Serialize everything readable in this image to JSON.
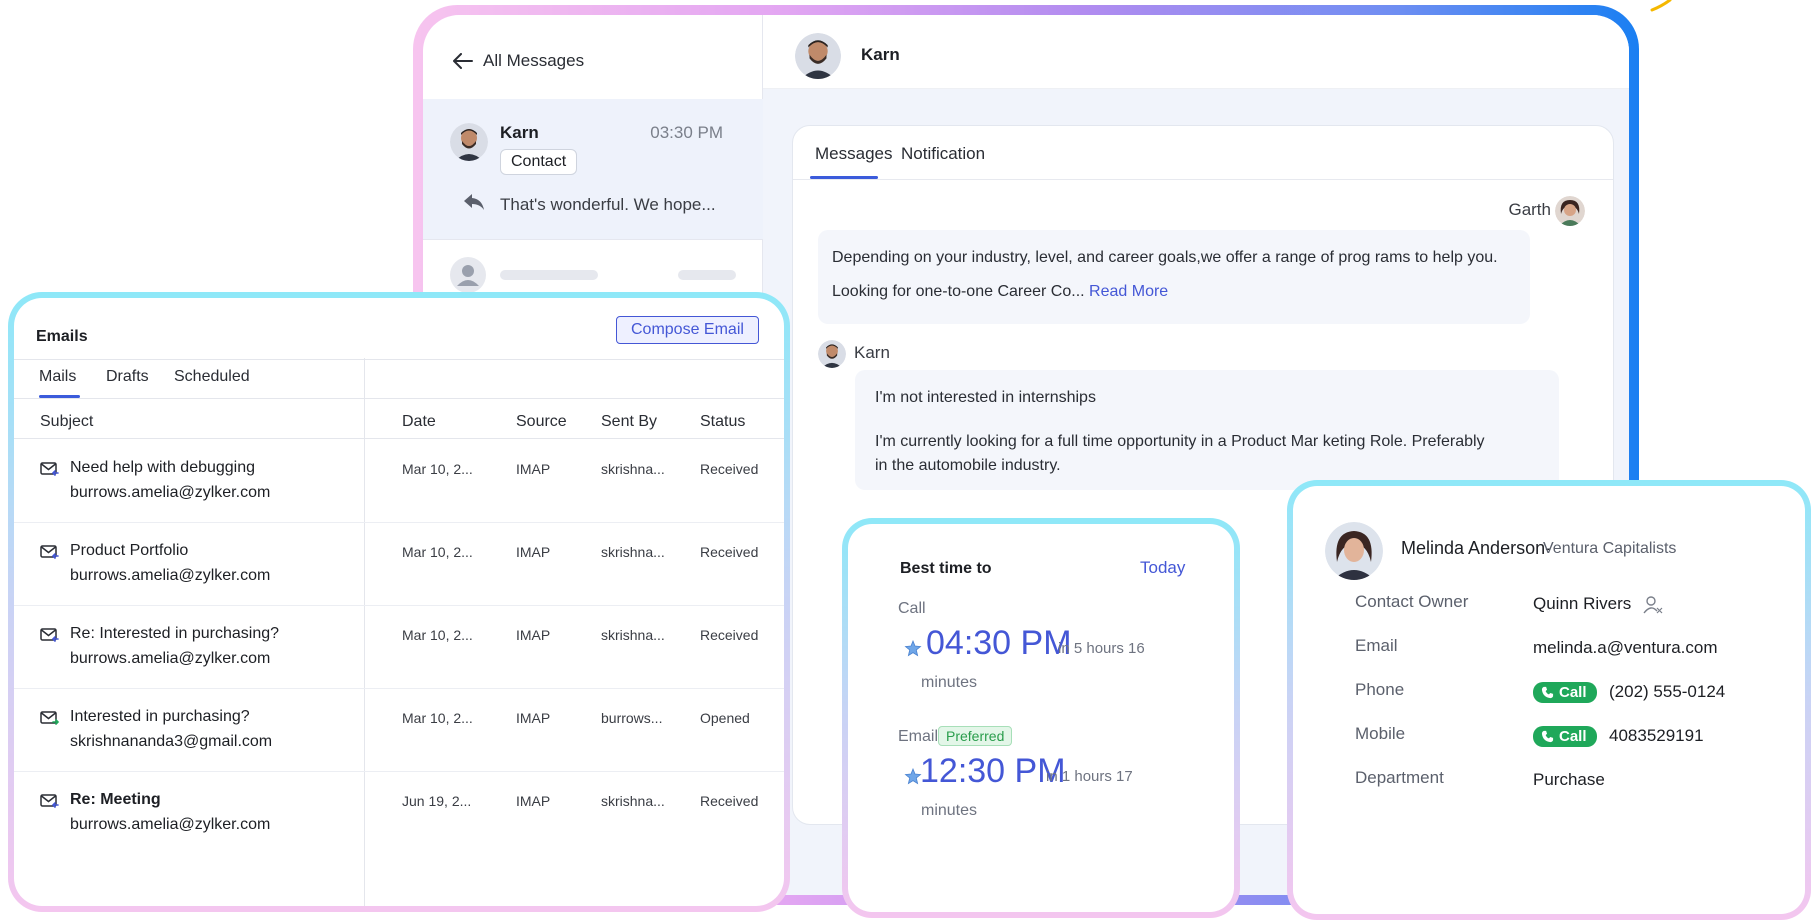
{
  "messages": {
    "back_label": "All Messages",
    "conversation": {
      "name": "Karn",
      "time": "03:30 PM",
      "tag": "Contact",
      "preview": "That's wonderful. We hope..."
    },
    "header_name": "Karn",
    "tabs": [
      "Messages",
      "Notification"
    ],
    "garth": {
      "name": "Garth",
      "line1": "Depending on  your industry, level, and career goals,we offer a  range of prog rams to help  you.",
      "line2": "Looking for one-to-one Career Co...",
      "read_more": "Read More"
    },
    "karn": {
      "name": "Karn",
      "line1": "I'm not interested in internships",
      "line2": "I'm currently looking for a full time opportunity in a Product Mar  keting Role. Preferably",
      "line3": "in the automobile industry."
    }
  },
  "emails": {
    "title": "Emails",
    "compose_label": "Compose Email",
    "tabs": [
      "Mails",
      "Drafts",
      "Scheduled"
    ],
    "columns": [
      "Subject",
      "Date",
      "Source",
      "Sent By",
      "Status"
    ],
    "rows": [
      {
        "subject": "Need help with debugging",
        "email": "burrows.amelia@zylker.com",
        "date": "Mar 10, 2...",
        "source": "IMAP",
        "sent_by": "skrishna...",
        "status": "Received",
        "bold": false
      },
      {
        "subject": "Product Portfolio",
        "email": "burrows.amelia@zylker.com",
        "date": "Mar 10, 2...",
        "source": "IMAP",
        "sent_by": "skrishna...",
        "status": "Received",
        "bold": false
      },
      {
        "subject": "Re: Interested in purchasing?",
        "email": "burrows.amelia@zylker.com",
        "date": "Mar 10, 2...",
        "source": "IMAP",
        "sent_by": "skrishna...",
        "status": "Received",
        "bold": false
      },
      {
        "subject": "Interested in purchasing?",
        "email": "skrishnananda3@gmail.com",
        "date": "Mar 10, 2...",
        "source": "IMAP",
        "sent_by": "burrows...",
        "status": "Opened",
        "bold": false
      },
      {
        "subject": "Re: Meeting",
        "email": "burrows.amelia@zylker.com",
        "date": "Jun 19, 2...",
        "source": "IMAP",
        "sent_by": "skrishna...",
        "status": "Received",
        "bold": true
      }
    ]
  },
  "best_time": {
    "title": "Best time to",
    "today_label": "Today",
    "call_label": "Call",
    "call_time": "04:30 PM",
    "call_in": "in 5 hours 16",
    "call_minutes": "minutes",
    "email_label": "Email",
    "preferred_label": "Preferred",
    "email_time": "12:30 PM",
    "email_in": "in 1 hours 17",
    "email_minutes": "minutes"
  },
  "contact": {
    "name": "Melinda Anderson-",
    "company": "Ventura Capitalists",
    "owner_label": "Contact Owner",
    "owner_value": "Quinn Rivers",
    "email_label": "Email",
    "email_value": "melinda.a@ventura.com",
    "phone_label": "Phone",
    "phone_value": "(202) 555-0124",
    "mobile_label": "Mobile",
    "mobile_value": "4083529191",
    "call_label": "Call",
    "department_label": "Department",
    "department_value": "Purchase"
  },
  "colors": {
    "accent": "#4457d6",
    "call_green": "#1fa85a",
    "selected_bg": "#eef2fb"
  }
}
